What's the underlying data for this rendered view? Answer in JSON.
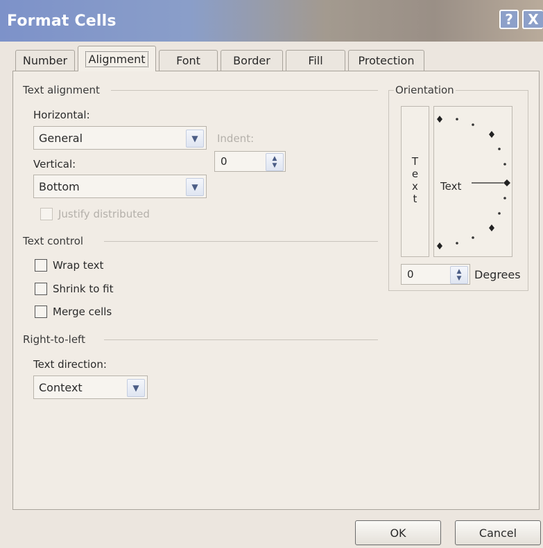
{
  "window": {
    "title": "Format Cells"
  },
  "titlebar": {
    "help_glyph": "?",
    "close_glyph": "X"
  },
  "tabs": [
    {
      "label": "Number",
      "active": false
    },
    {
      "label": "Alignment",
      "active": true
    },
    {
      "label": "Font",
      "active": false
    },
    {
      "label": "Border",
      "active": false
    },
    {
      "label": "Fill",
      "active": false
    },
    {
      "label": "Protection",
      "active": false
    }
  ],
  "text_alignment": {
    "group_label": "Text alignment",
    "horizontal_label": "Horizontal:",
    "horizontal_value": "General",
    "indent_label": "Indent:",
    "indent_value": "0",
    "vertical_label": "Vertical:",
    "vertical_value": "Bottom",
    "justify_distributed_label": "Justify distributed",
    "justify_distributed_checked": false
  },
  "text_control": {
    "group_label": "Text control",
    "wrap_text_label": "Wrap text",
    "shrink_to_fit_label": "Shrink to fit",
    "merge_cells_label": "Merge cells"
  },
  "right_to_left": {
    "group_label": "Right-to-left",
    "text_direction_label": "Text direction:",
    "text_direction_value": "Context"
  },
  "orientation": {
    "group_label": "Orientation",
    "vertical_text_chars": [
      "T",
      "e",
      "x",
      "t"
    ],
    "dial_text": "Text",
    "degrees_value": "0",
    "degrees_label": "Degrees"
  },
  "buttons": {
    "ok_label": "OK",
    "cancel_label": "Cancel"
  },
  "colors": {
    "title_blue": "#7d92c9",
    "dialog_bg": "#ece6df",
    "arrow_blue": "#4b5d86"
  }
}
